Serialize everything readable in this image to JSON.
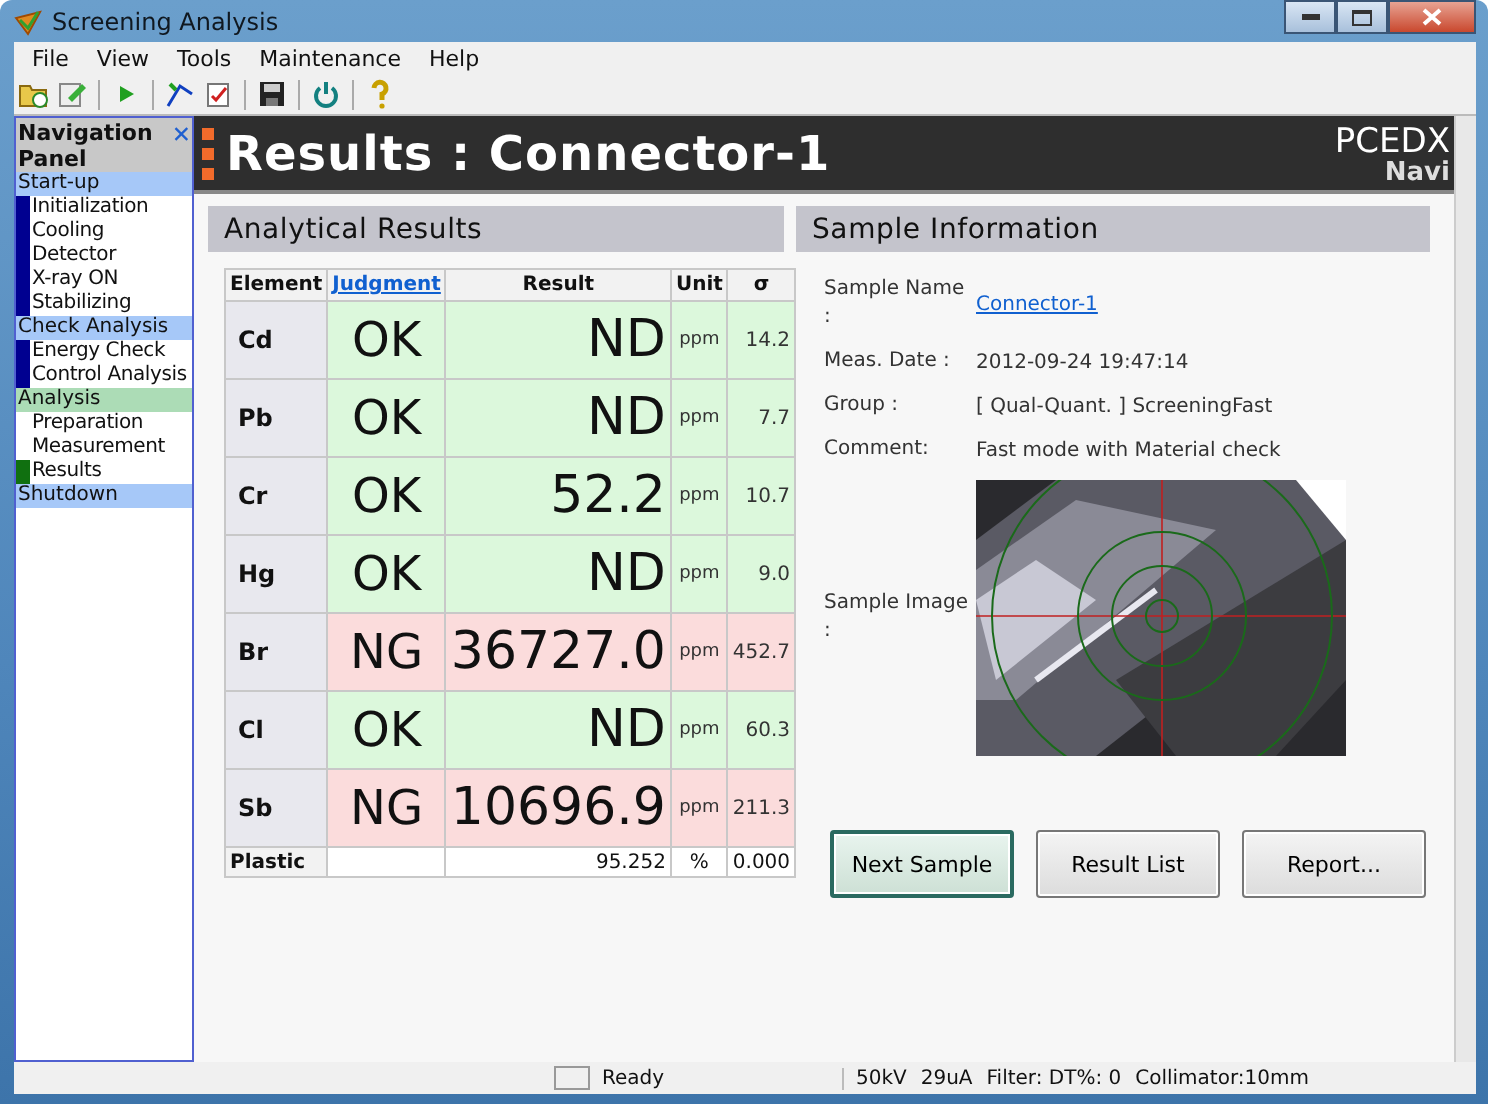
{
  "window": {
    "title": "Screening Analysis"
  },
  "menu": [
    "File",
    "View",
    "Tools",
    "Maintenance",
    "Help"
  ],
  "navigation": {
    "title": "Navigation Panel",
    "groups": [
      {
        "label": "Start-up",
        "current": false,
        "children": [
          {
            "label": "Initialization",
            "done": true,
            "current": false
          },
          {
            "label": "Cooling",
            "done": true,
            "current": false
          },
          {
            "label": "Detector",
            "done": true,
            "current": false
          },
          {
            "label": "X-ray ON",
            "done": true,
            "current": false
          },
          {
            "label": "Stabilizing",
            "done": true,
            "current": false
          }
        ]
      },
      {
        "label": "Check Analysis",
        "current": false,
        "children": [
          {
            "label": "Energy Check",
            "done": true,
            "current": false
          },
          {
            "label": "Control Analysis",
            "done": true,
            "current": false
          }
        ]
      },
      {
        "label": "Analysis",
        "current": true,
        "children": [
          {
            "label": "Preparation",
            "done": false,
            "current": false
          },
          {
            "label": "Measurement",
            "done": false,
            "current": false
          },
          {
            "label": "Results",
            "done": false,
            "current": true
          }
        ]
      },
      {
        "label": "Shutdown",
        "current": false
      }
    ]
  },
  "header": {
    "title": "Results : Connector-1",
    "logo": "PCEDX",
    "logo_sub": "Navi"
  },
  "analytical_results": {
    "title": "Analytical Results",
    "columns": [
      "Element",
      "Judgment",
      "Result",
      "Unit",
      "σ"
    ],
    "rows": [
      {
        "kind": "ok",
        "element": "Cd",
        "judgment": "OK",
        "result": "ND",
        "unit": "ppm",
        "sigma": "14.2"
      },
      {
        "kind": "ok",
        "element": "Pb",
        "judgment": "OK",
        "result": "ND",
        "unit": "ppm",
        "sigma": "7.7"
      },
      {
        "kind": "ok",
        "element": "Cr",
        "judgment": "OK",
        "result": "52.2",
        "unit": "ppm",
        "sigma": "10.7"
      },
      {
        "kind": "ok",
        "element": "Hg",
        "judgment": "OK",
        "result": "ND",
        "unit": "ppm",
        "sigma": "9.0"
      },
      {
        "kind": "ng",
        "element": "Br",
        "judgment": "NG",
        "result": "36727.0",
        "unit": "ppm",
        "sigma": "452.7"
      },
      {
        "kind": "ok",
        "element": "Cl",
        "judgment": "OK",
        "result": "ND",
        "unit": "ppm",
        "sigma": "60.3"
      },
      {
        "kind": "ng",
        "element": "Sb",
        "judgment": "NG",
        "result": "10696.9",
        "unit": "ppm",
        "sigma": "211.3"
      },
      {
        "kind": "summary",
        "element": "Plastic",
        "result": "95.252",
        "unit": "%",
        "sigma": "0.000"
      }
    ]
  },
  "sample_information": {
    "title": "Sample Information",
    "fields": [
      {
        "kind": "link",
        "label": "Sample Name :",
        "value": "Connector-1"
      },
      {
        "kind": "text",
        "label": "Meas. Date :",
        "value": "2012-09-24 19:47:14"
      },
      {
        "kind": "text",
        "label": "Group :",
        "value": "[ Qual-Quant. ] ScreeningFast"
      },
      {
        "kind": "text",
        "label": "Comment:",
        "value": "Fast mode with Material check"
      },
      {
        "kind": "picture",
        "label": "Sample Image :"
      }
    ],
    "buttons": [
      {
        "label": "Next Sample",
        "selected": true
      },
      {
        "label": "Result List",
        "selected": false
      },
      {
        "label": "Report...",
        "selected": false
      }
    ]
  },
  "status_bar": {
    "message": "Ready",
    "details": [
      "50kV",
      "29uA",
      "Filter: DT%: 0",
      "Collimator:10mm"
    ]
  }
}
